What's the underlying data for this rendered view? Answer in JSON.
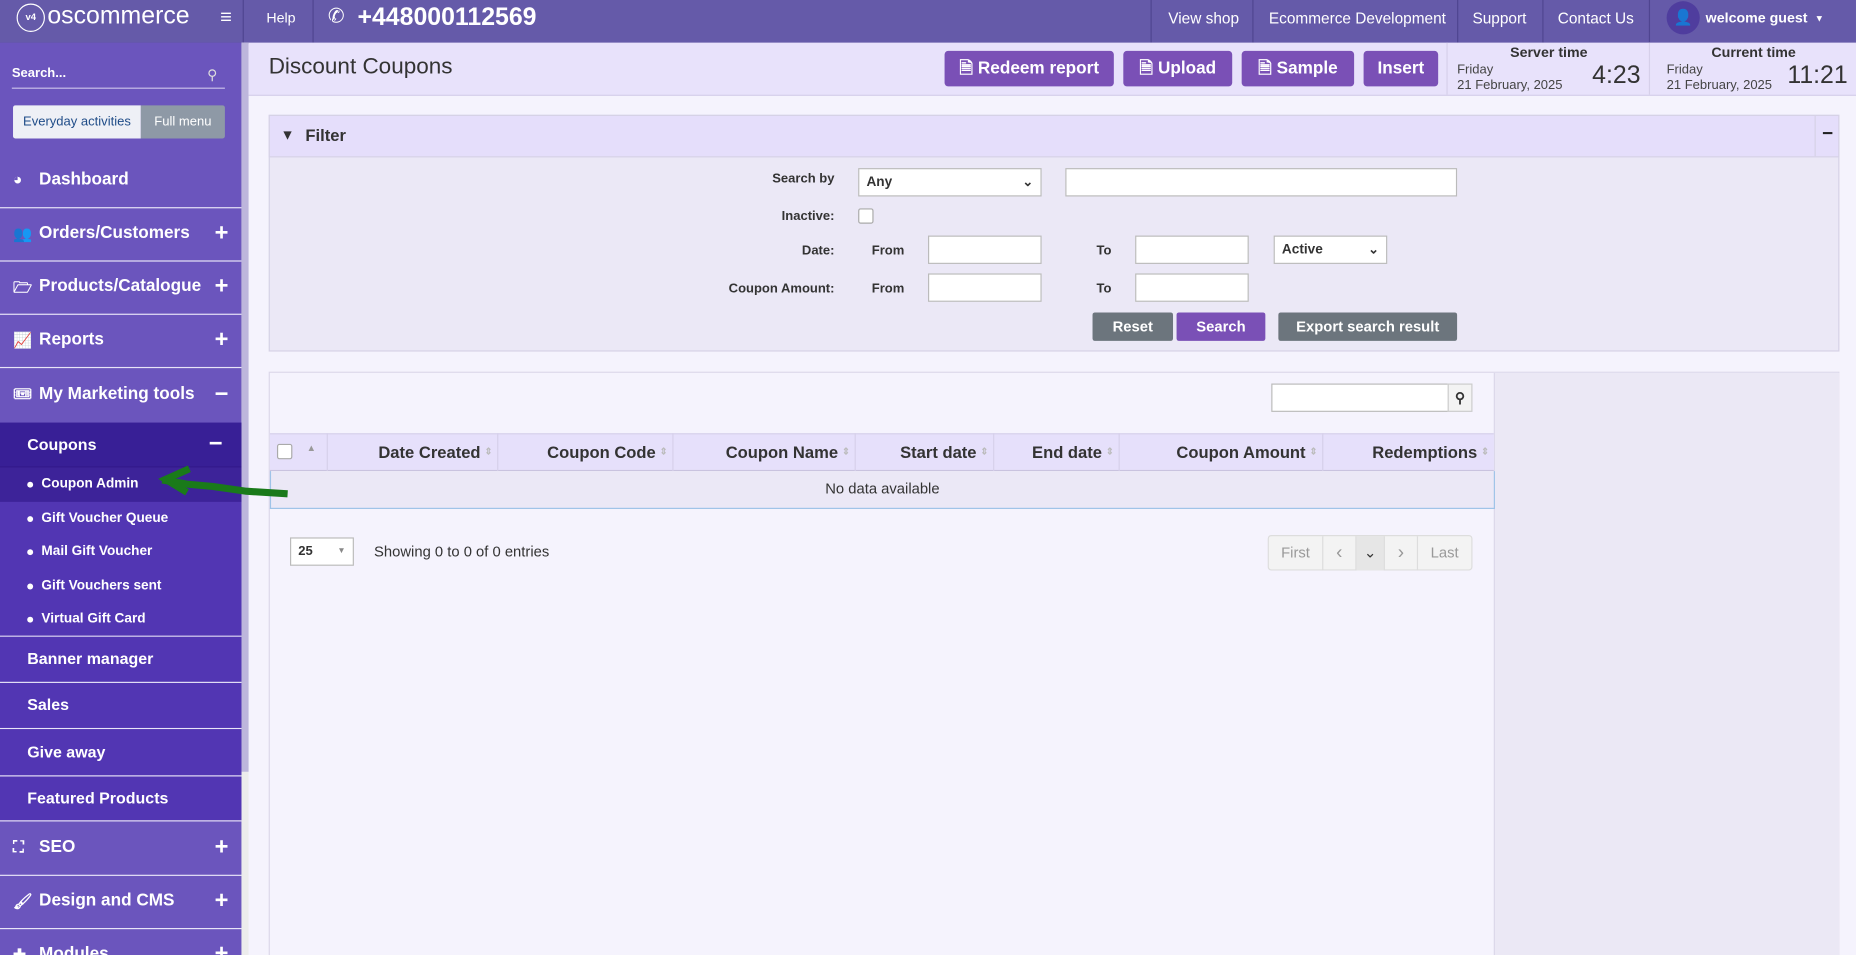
{
  "topbar": {
    "logo_text": "oscommerce",
    "logo_badge": "v4",
    "help": "Help",
    "phone": "+448000112569",
    "nav": [
      "View shop",
      "Ecommerce Development",
      "Support",
      "Contact Us"
    ],
    "user": "welcome guest"
  },
  "sidebar": {
    "search_placeholder": "Search...",
    "toggle": [
      "Everyday activities",
      "Full menu"
    ],
    "items": [
      {
        "label": "Dashboard",
        "icon": "dashboard-icon"
      },
      {
        "label": "Orders/Customers",
        "icon": "users-icon",
        "toggle": "+"
      },
      {
        "label": "Products/Catalogue",
        "icon": "folder-icon",
        "toggle": "+"
      },
      {
        "label": "Reports",
        "icon": "chart-icon",
        "toggle": "+"
      },
      {
        "label": "My Marketing tools",
        "icon": "ticket-icon",
        "toggle": "−"
      },
      {
        "label": "SEO",
        "icon": "sitemap-icon",
        "toggle": "+"
      },
      {
        "label": "Design and CMS",
        "icon": "brush-icon",
        "toggle": "+"
      },
      {
        "label": "Modules",
        "icon": "puzzle-icon",
        "toggle": "+"
      }
    ],
    "marketing_sub": {
      "coupons": {
        "label": "Coupons",
        "toggle": "−"
      },
      "coupon_children": [
        "Coupon Admin",
        "Gift Voucher Queue",
        "Mail Gift Voucher",
        "Gift Vouchers sent",
        "Virtual Gift Card"
      ],
      "others": [
        "Banner manager",
        "Sales",
        "Give away",
        "Featured Products"
      ]
    }
  },
  "header": {
    "title": "Discount Coupons",
    "buttons": [
      "Redeem report",
      "Upload",
      "Sample",
      "Insert"
    ],
    "server_time": {
      "label": "Server time",
      "day": "Friday",
      "date": "21 February, 2025",
      "time": "4:23"
    },
    "current_time": {
      "label": "Current time",
      "day": "Friday",
      "date": "21 February, 2025",
      "time": "11:21"
    }
  },
  "filter": {
    "title": "Filter",
    "collapse": "−",
    "search_by_label": "Search by",
    "search_by_value": "Any",
    "search_value": "",
    "inactive_label": "Inactive:",
    "date_label": "Date:",
    "amount_label": "Coupon Amount:",
    "from": "From",
    "to": "To",
    "status_value": "Active",
    "reset": "Reset",
    "search": "Search",
    "export": "Export search result"
  },
  "table": {
    "search_value": "",
    "columns": [
      "Date Created",
      "Coupon Code",
      "Coupon Name",
      "Start date",
      "End date",
      "Coupon Amount",
      "Redemptions"
    ],
    "empty": "No data available",
    "page_size": "25",
    "info": "Showing 0 to 0 of 0 entries",
    "pagination": [
      "First",
      "‹",
      "⌄",
      "›",
      "Last"
    ]
  },
  "colors": {
    "topbar": "#655aa9",
    "sidebar": "#6b55bd",
    "accent_button": "#7a50b6",
    "annotation_arrow": "#1a7a1a"
  }
}
